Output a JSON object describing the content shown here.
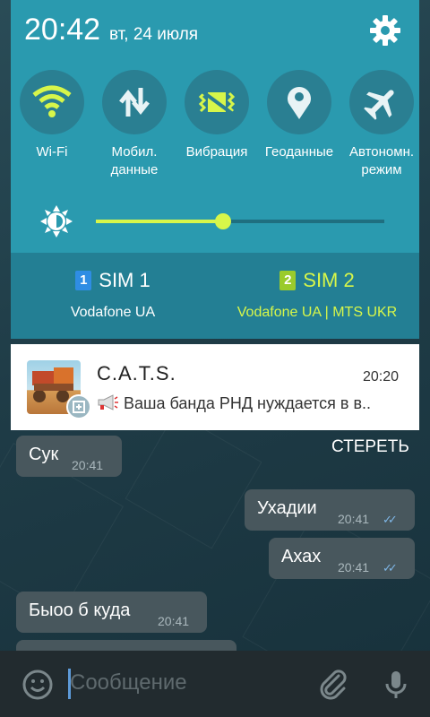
{
  "status": {
    "time": "20:42",
    "date": "вт, 24 июля"
  },
  "toggles": [
    {
      "name": "Wi-Fi",
      "icon": "wifi-icon",
      "active": true
    },
    {
      "name": "Мобил. данные",
      "line1": "Мобил.",
      "line2": "данные",
      "icon": "mobile-data-icon",
      "active": false
    },
    {
      "name": "Вибрация",
      "icon": "vibration-icon",
      "active": true
    },
    {
      "name": "Геоданные",
      "icon": "location-icon",
      "active": false
    },
    {
      "name": "Автономн. режим",
      "line1": "Автономн.",
      "line2": "режим",
      "icon": "airplane-icon",
      "active": false
    }
  ],
  "brightness": {
    "level": 0.44
  },
  "sims": [
    {
      "badge": "1",
      "name": "SIM 1",
      "carrier": "Vodafone UA",
      "color": "#ffffff",
      "badge_color": "#2f8de4"
    },
    {
      "badge": "2",
      "name": "SIM 2",
      "carrier": "Vodafone UA | MTS UKR",
      "color": "#d7f64a",
      "badge_color": "#9acb2c"
    }
  ],
  "notification": {
    "title": "C.A.T.S.",
    "time": "20:20",
    "text": "Ваша банда РНД нуждается в в.."
  },
  "clear_label": "СТЕРЕТЬ",
  "messages": [
    {
      "text": "Сук",
      "time": "20:41",
      "outgoing": false
    },
    {
      "text": "Ухадии",
      "time": "20:41",
      "outgoing": true,
      "ticks": "✓✓"
    },
    {
      "text": "Ахах",
      "time": "20:41",
      "outgoing": true,
      "ticks": "✓✓"
    },
    {
      "text": "Быоо б куда",
      "time": "20:41",
      "outgoing": false
    }
  ],
  "input": {
    "placeholder": "Сообщение"
  },
  "colors": {
    "accent": "#d7f64a",
    "panel": "#2a9aaf",
    "sim_bar": "#237f94"
  }
}
